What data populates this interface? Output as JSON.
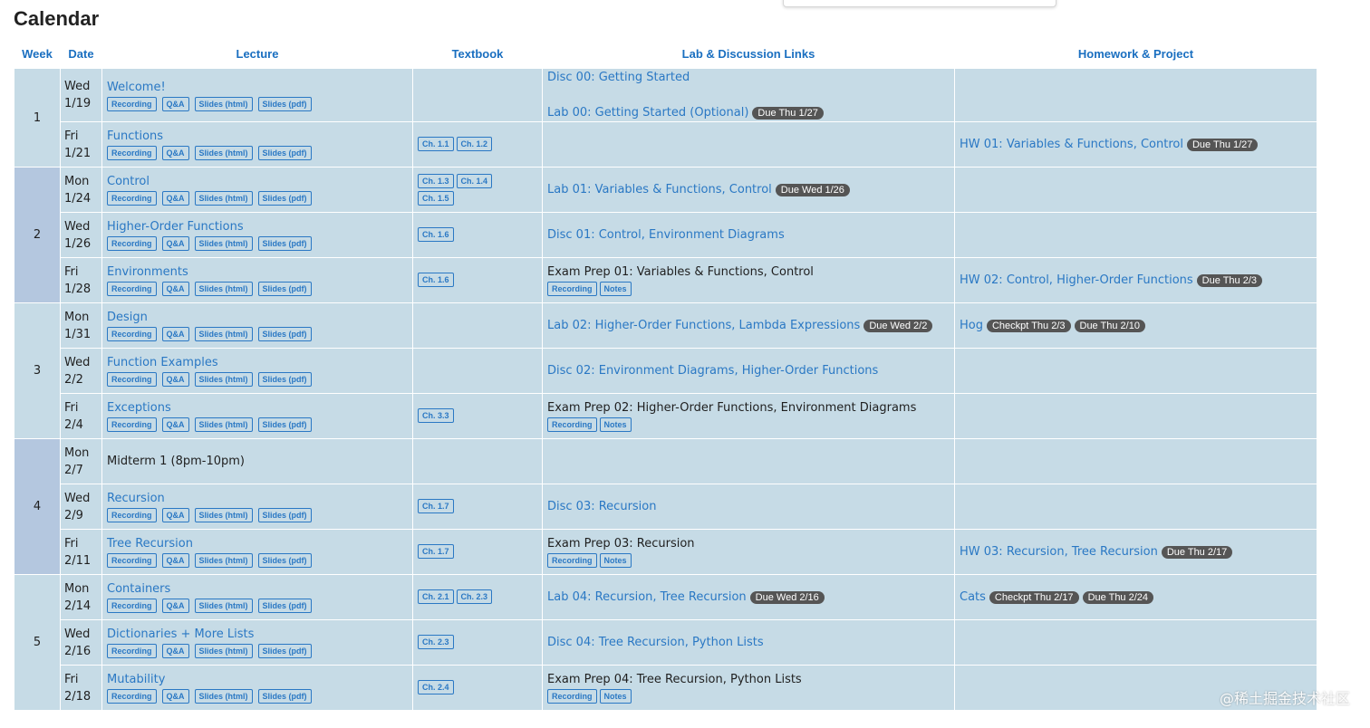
{
  "page": {
    "title": "Calendar",
    "watermark": "@稀土掘金技术社区"
  },
  "headers": {
    "week": "Week",
    "date": "Date",
    "lecture": "Lecture",
    "textbook": "Textbook",
    "lab": "Lab & Discussion Links",
    "hw": "Homework & Project"
  },
  "lecture_resources": [
    "Recording",
    "Q&A",
    "Slides (html)",
    "Slides (pdf)"
  ],
  "exam_prep_resources": [
    "Recording",
    "Notes"
  ],
  "weeks": [
    {
      "week": "1",
      "days": [
        {
          "day": "Wed",
          "date": "1/19",
          "lecture": "Welcome!",
          "textbook": [],
          "lab": [
            {
              "text": "Disc 00: Getting Started"
            },
            {
              "text": "Lab 00: Getting Started (Optional)",
              "badges": [
                "Due Thu 1/27"
              ]
            }
          ],
          "hw": []
        },
        {
          "day": "Fri",
          "date": "1/21",
          "lecture": "Functions",
          "textbook": [
            "Ch. 1.1",
            "Ch. 1.2"
          ],
          "lab": [],
          "hw": [
            {
              "text": "HW 01: Variables & Functions, Control",
              "badges": [
                "Due Thu 1/27"
              ]
            }
          ]
        }
      ]
    },
    {
      "week": "2",
      "days": [
        {
          "day": "Mon",
          "date": "1/24",
          "lecture": "Control",
          "textbook": [
            "Ch. 1.3",
            "Ch. 1.4",
            "Ch. 1.5"
          ],
          "lab": [
            {
              "text": "Lab 01: Variables & Functions, Control",
              "badges": [
                "Due Wed 1/26"
              ]
            }
          ],
          "hw": []
        },
        {
          "day": "Wed",
          "date": "1/26",
          "lecture": "Higher-Order Functions",
          "textbook": [
            "Ch. 1.6"
          ],
          "lab": [
            {
              "text": "Disc 01: Control, Environment Diagrams"
            }
          ],
          "hw": []
        },
        {
          "day": "Fri",
          "date": "1/28",
          "lecture": "Environments",
          "textbook": [
            "Ch. 1.6"
          ],
          "exam_prep": "Exam Prep 01: Variables & Functions, Control",
          "lab": [],
          "hw": [
            {
              "text": "HW 02: Control, Higher-Order Functions",
              "badges": [
                "Due Thu 2/3"
              ]
            }
          ]
        }
      ]
    },
    {
      "week": "3",
      "days": [
        {
          "day": "Mon",
          "date": "1/31",
          "lecture": "Design",
          "textbook": [],
          "lab": [
            {
              "text": "Lab 02: Higher-Order Functions, Lambda Expressions",
              "badges": [
                "Due Wed 2/2"
              ]
            }
          ],
          "hw": [
            {
              "text": "Hog",
              "badges": [
                "Checkpt Thu 2/3",
                "Due Thu 2/10"
              ]
            }
          ]
        },
        {
          "day": "Wed",
          "date": "2/2",
          "lecture": "Function Examples",
          "textbook": [],
          "lab": [
            {
              "text": "Disc 02: Environment Diagrams, Higher-Order Functions"
            }
          ],
          "hw": []
        },
        {
          "day": "Fri",
          "date": "2/4",
          "lecture": "Exceptions",
          "textbook": [
            "Ch. 3.3"
          ],
          "exam_prep": "Exam Prep 02: Higher-Order Functions, Environment Diagrams",
          "lab": [],
          "hw": []
        }
      ]
    },
    {
      "week": "4",
      "days": [
        {
          "day": "Mon",
          "date": "2/7",
          "lecture": "Midterm 1 (8pm-10pm)",
          "plain": true,
          "textbook": [],
          "lab": [],
          "hw": []
        },
        {
          "day": "Wed",
          "date": "2/9",
          "lecture": "Recursion",
          "textbook": [
            "Ch. 1.7"
          ],
          "lab": [
            {
              "text": "Disc 03: Recursion"
            }
          ],
          "hw": []
        },
        {
          "day": "Fri",
          "date": "2/11",
          "lecture": "Tree Recursion",
          "textbook": [
            "Ch. 1.7"
          ],
          "exam_prep": "Exam Prep 03: Recursion",
          "lab": [],
          "hw": [
            {
              "text": "HW 03: Recursion, Tree Recursion",
              "badges": [
                "Due Thu 2/17"
              ]
            }
          ]
        }
      ]
    },
    {
      "week": "5",
      "days": [
        {
          "day": "Mon",
          "date": "2/14",
          "lecture": "Containers",
          "textbook": [
            "Ch. 2.1",
            "Ch. 2.3"
          ],
          "lab": [
            {
              "text": "Lab 04: Recursion, Tree Recursion",
              "badges": [
                "Due Wed 2/16"
              ]
            }
          ],
          "hw": [
            {
              "text": "Cats",
              "badges": [
                "Checkpt Thu 2/17",
                "Due Thu 2/24"
              ]
            }
          ]
        },
        {
          "day": "Wed",
          "date": "2/16",
          "lecture": "Dictionaries + More Lists",
          "textbook": [
            "Ch. 2.3"
          ],
          "lab": [
            {
              "text": "Disc 04: Tree Recursion, Python Lists"
            }
          ],
          "hw": []
        },
        {
          "day": "Fri",
          "date": "2/18",
          "lecture": "Mutability",
          "textbook": [
            "Ch. 2.4"
          ],
          "exam_prep": "Exam Prep 04: Tree Recursion, Python Lists",
          "lab": [],
          "hw": []
        }
      ]
    }
  ]
}
